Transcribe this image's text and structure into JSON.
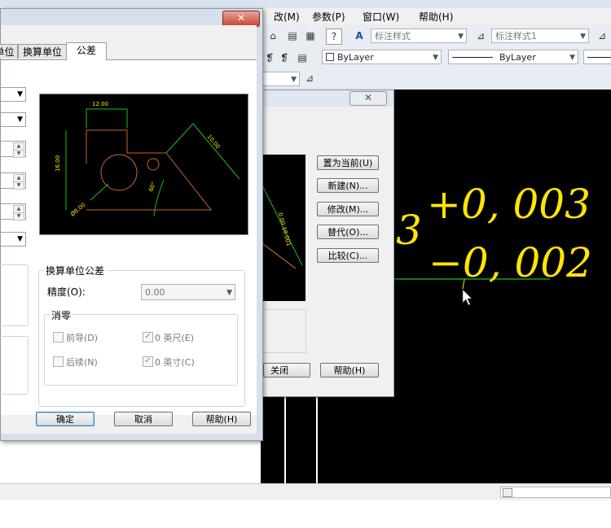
{
  "menubar": {
    "items": [
      {
        "label": "改(M)"
      },
      {
        "label": "参数(P)"
      },
      {
        "label": "窗口(W)"
      },
      {
        "label": "帮助(H)"
      }
    ]
  },
  "toolbar": {
    "dimstyle_combo": "标注样式",
    "dimstyle_combo2": "标注样式1",
    "layer_combo": "ByLayer",
    "linetype_combo": "ByLayer"
  },
  "style_manager": {
    "buttons": {
      "set_current": "置为当前(U)",
      "new": "新建(N)...",
      "modify": "修改(M)...",
      "override": "替代(O)...",
      "compare": "比较(C)...",
      "close": "关闭",
      "help": "帮助(H)"
    }
  },
  "modify_dialog": {
    "tabs": [
      {
        "label": "单位"
      },
      {
        "label": "换算单位"
      },
      {
        "label": "公差"
      }
    ],
    "alt_tolerance": {
      "group_title": "换算单位公差",
      "precision_label": "精度(O):",
      "precision_value": "0.00",
      "zero_group_title": "消零",
      "leading_label": "前导(D)",
      "trailing_label": "后续(N)",
      "feet_label": "0 英尺(E)",
      "inches_label": "0 英寸(C)",
      "feet_checked": "✓",
      "inches_checked": "✓"
    },
    "buttons": {
      "ok": "确定",
      "cancel": "取消",
      "help": "帮助(H)"
    }
  },
  "canvas": {
    "dimension_text": "3",
    "upper_tolerance": "+0, 003",
    "lower_tolerance": "−0, 002"
  },
  "colors": {
    "dimension_yellow": "#ffe600",
    "dimension_green": "#19c219"
  }
}
